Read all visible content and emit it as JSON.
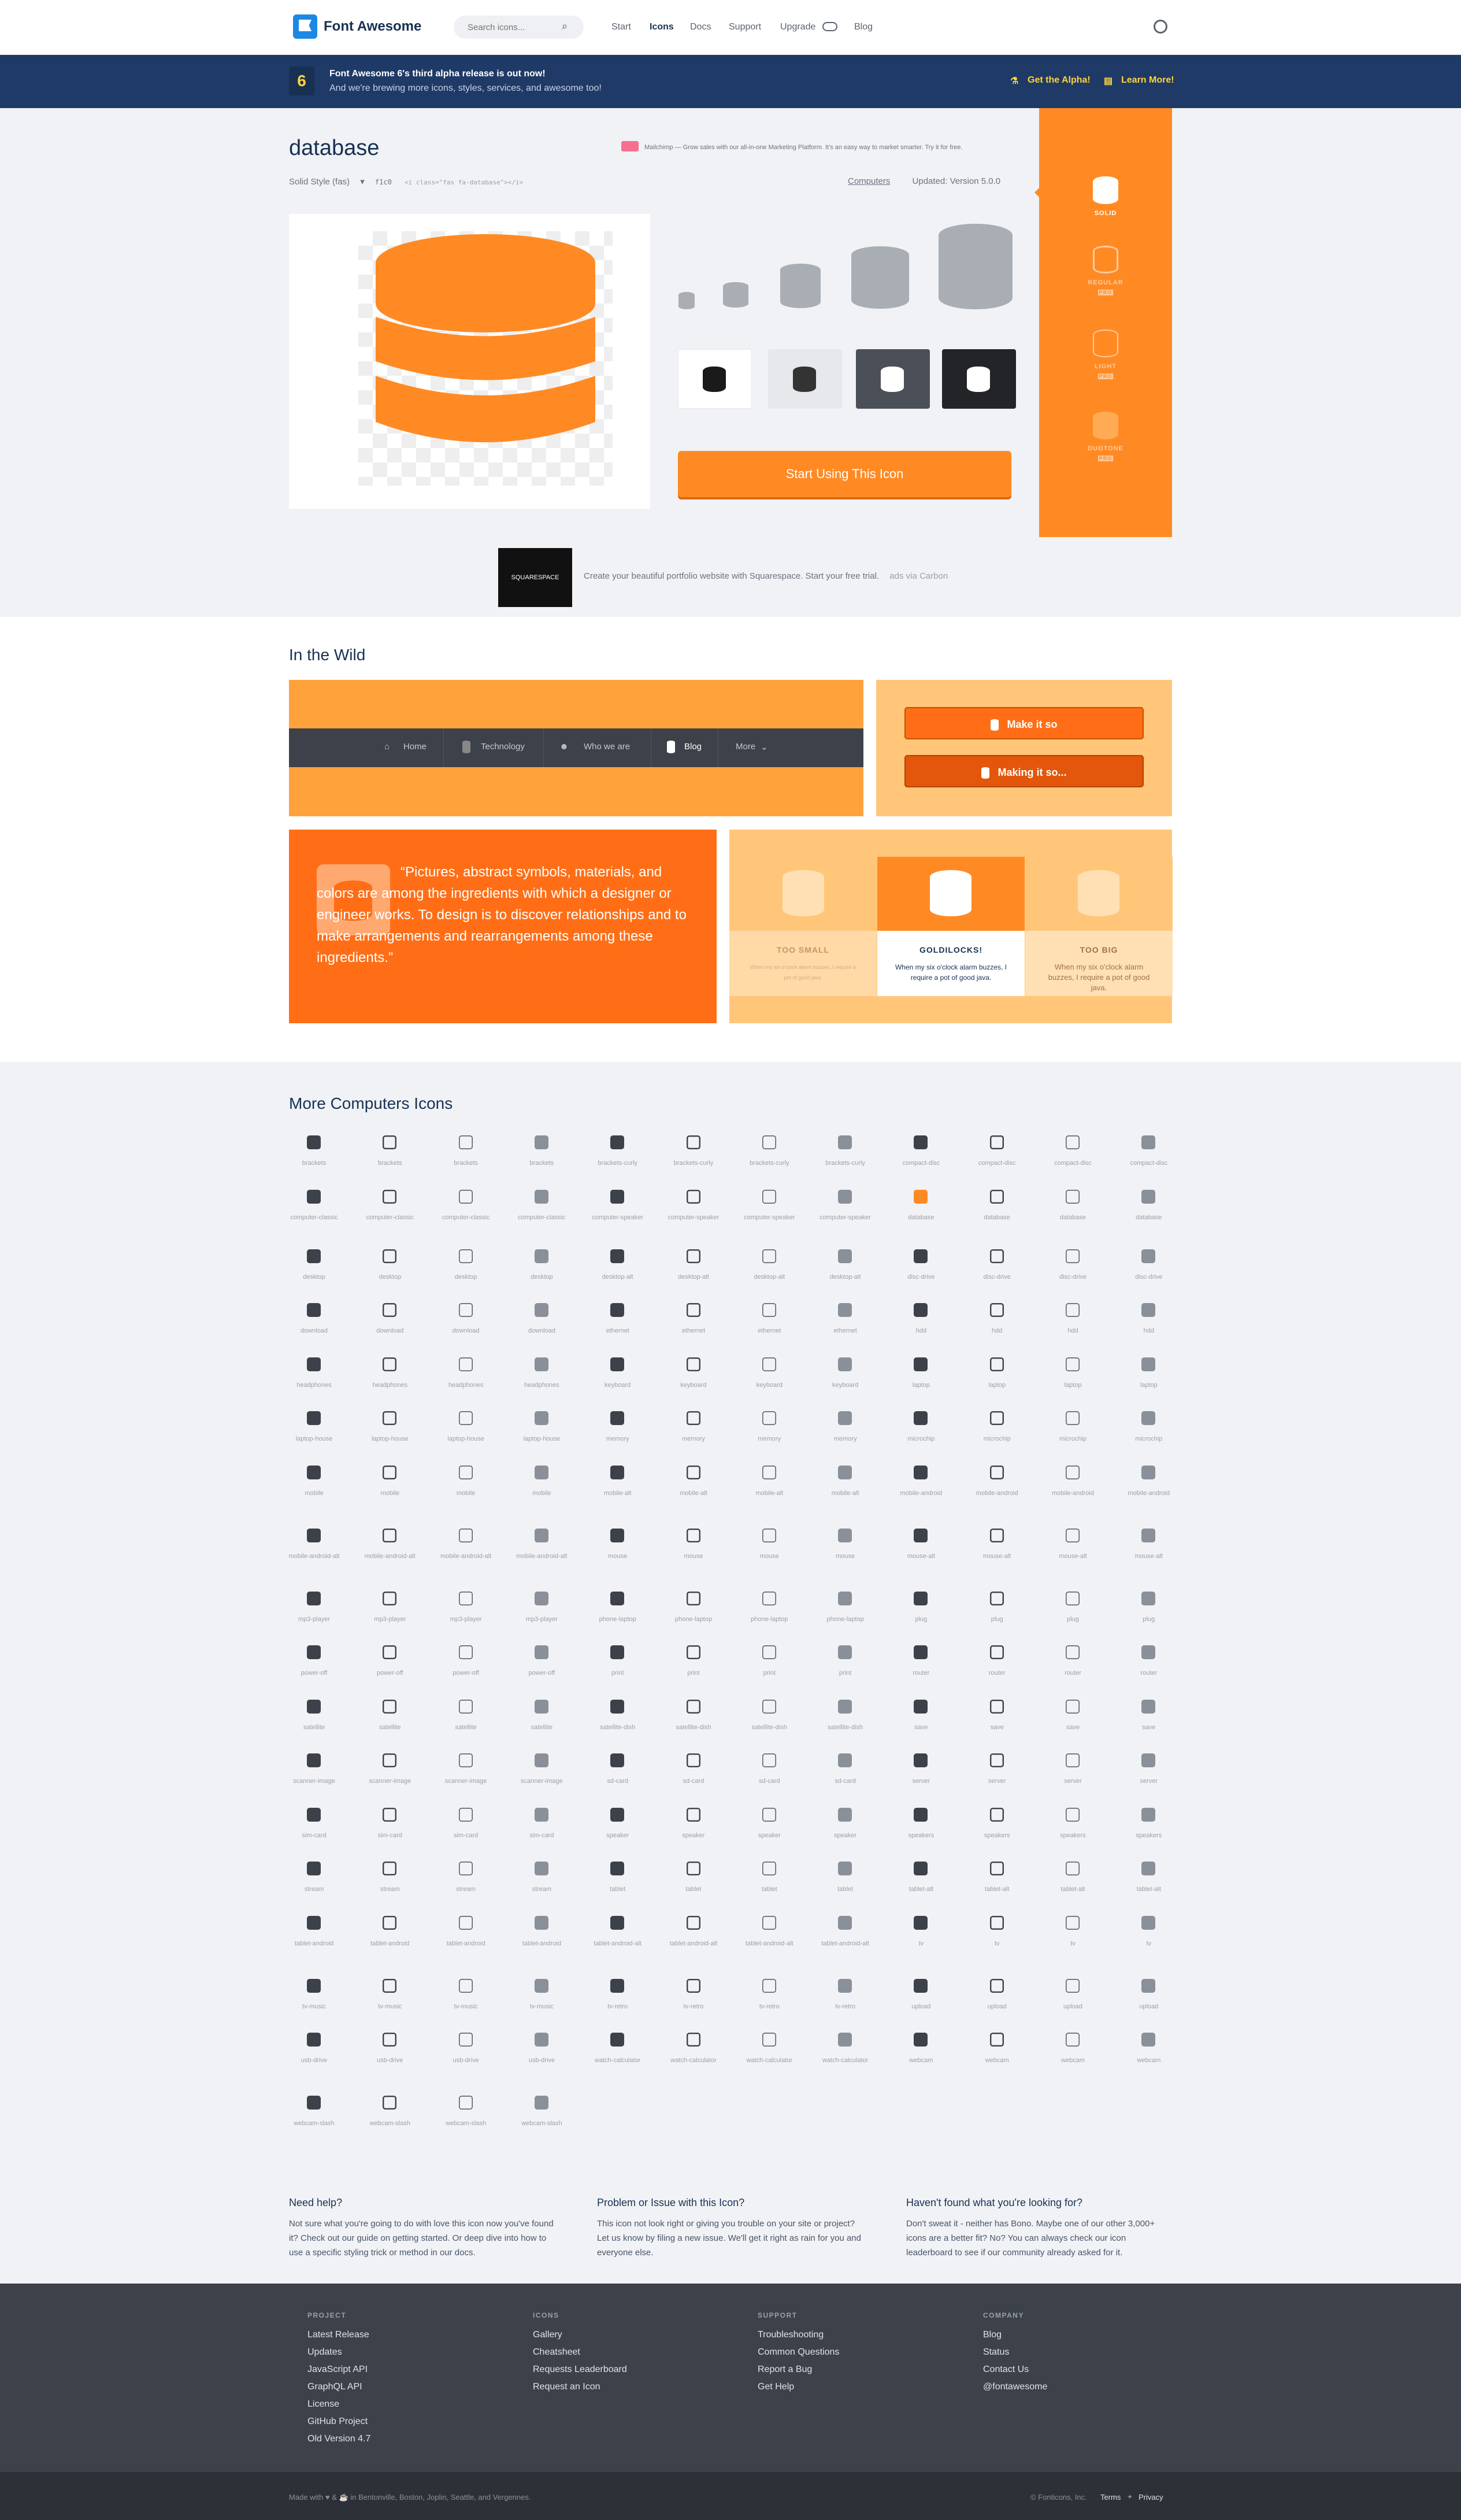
{
  "header": {
    "brand": "Font Awesome",
    "search_placeholder": "Search icons...",
    "nav": [
      "Start",
      "Icons",
      "Docs",
      "Support",
      "Upgrade",
      "Blog"
    ]
  },
  "banner": {
    "badge": "6",
    "headline": "Font Awesome 6's third alpha release is out now!",
    "subline": "And we're brewing more icons, styles, services, and awesome too!",
    "alpha_label": "Get the Alpha!",
    "learn_label": "Learn More!"
  },
  "icon": {
    "name": "database",
    "style_label": "Solid Style (fas)",
    "unicode": "f1c0",
    "snippet": "<i class=\"fas fa-database\"></i>",
    "category": "Computers",
    "updated": "Updated: Version 5.0.0",
    "ad": "Mailchimp — Grow sales with our all-in-one Marketing Platform. It's an easy way to market smarter. Try it for free.",
    "cta": "Start Using This Icon"
  },
  "styles": [
    "SOLID",
    "REGULAR",
    "LIGHT",
    "DUOTONE"
  ],
  "pro_badge": "PRO",
  "carbon": {
    "logo": "SQUARESPACE",
    "text": "Create your beautiful portfolio website with Squarespace. Start your free trial.",
    "via": "ads via Carbon"
  },
  "wild": {
    "title": "In the Wild",
    "nav_items": [
      "Home",
      "Technology",
      "Who we are",
      "Blog",
      "More"
    ],
    "button1": "Make it so",
    "button2": "Making it so...",
    "quote": "“Pictures, abstract symbols, materials, and colors are among the ingredients with which a designer or engineer works. To design is to discover relationships and to make arrangements and rearrangements among these ingredients.”",
    "sizes": [
      {
        "label": "TOO SMALL",
        "desc": "When my six o'clock alarm buzzes, I require a pot of good java."
      },
      {
        "label": "GOLDILOCKS!",
        "desc": "When my six o'clock alarm buzzes, I require a pot of good java."
      },
      {
        "label": "TOO BIG",
        "desc": "When my six o'clock alarm buzzes, I require a pot of good java."
      }
    ]
  },
  "more": {
    "title": "More Computers Icons",
    "labels": [
      "brackets",
      "brackets",
      "brackets",
      "brackets",
      "brackets-curly",
      "brackets-curly",
      "brackets-curly",
      "brackets-curly",
      "compact-disc",
      "compact-disc",
      "compact-disc",
      "compact-disc",
      "computer-classic",
      "computer-classic",
      "computer-classic",
      "computer-classic",
      "computer-speaker",
      "computer-speaker",
      "computer-speaker",
      "computer-speaker",
      "database",
      "database",
      "database",
      "database",
      "desktop",
      "desktop",
      "desktop",
      "desktop",
      "desktop-alt",
      "desktop-alt",
      "desktop-alt",
      "desktop-alt",
      "disc-drive",
      "disc-drive",
      "disc-drive",
      "disc-drive",
      "download",
      "download",
      "download",
      "download",
      "ethernet",
      "ethernet",
      "ethernet",
      "ethernet",
      "hdd",
      "hdd",
      "hdd",
      "hdd",
      "headphones",
      "headphones",
      "headphones",
      "headphones",
      "keyboard",
      "keyboard",
      "keyboard",
      "keyboard",
      "laptop",
      "laptop",
      "laptop",
      "laptop",
      "laptop-house",
      "laptop-house",
      "laptop-house",
      "laptop-house",
      "memory",
      "memory",
      "memory",
      "memory",
      "microchip",
      "microchip",
      "microchip",
      "microchip",
      "mobile",
      "mobile",
      "mobile",
      "mobile",
      "mobile-alt",
      "mobile-alt",
      "mobile-alt",
      "mobile-alt",
      "mobile-android",
      "mobile-android",
      "mobile-android",
      "mobile-android",
      "mobile-android-alt",
      "mobile-android-alt",
      "mobile-android-alt",
      "mobile-android-alt",
      "mouse",
      "mouse",
      "mouse",
      "mouse",
      "mouse-alt",
      "mouse-alt",
      "mouse-alt",
      "mouse-alt",
      "mp3-player",
      "mp3-player",
      "mp3-player",
      "mp3-player",
      "phone-laptop",
      "phone-laptop",
      "phone-laptop",
      "phone-laptop",
      "plug",
      "plug",
      "plug",
      "plug",
      "power-off",
      "power-off",
      "power-off",
      "power-off",
      "print",
      "print",
      "print",
      "print",
      "router",
      "router",
      "router",
      "router",
      "satellite",
      "satellite",
      "satellite",
      "satellite",
      "satellite-dish",
      "satellite-dish",
      "satellite-dish",
      "satellite-dish",
      "save",
      "save",
      "save",
      "save",
      "scanner-image",
      "scanner-image",
      "scanner-image",
      "scanner-image",
      "sd-card",
      "sd-card",
      "sd-card",
      "sd-card",
      "server",
      "server",
      "server",
      "server",
      "sim-card",
      "sim-card",
      "sim-card",
      "sim-card",
      "speaker",
      "speaker",
      "speaker",
      "speaker",
      "speakers",
      "speakers",
      "speakers",
      "speakers",
      "stream",
      "stream",
      "stream",
      "stream",
      "tablet",
      "tablet",
      "tablet",
      "tablet",
      "tablet-alt",
      "tablet-alt",
      "tablet-alt",
      "tablet-alt",
      "tablet-android",
      "tablet-android",
      "tablet-android",
      "tablet-android",
      "tablet-android-alt",
      "tablet-android-alt",
      "tablet-android-alt",
      "tablet-android-alt",
      "tv",
      "tv",
      "tv",
      "tv",
      "tv-music",
      "tv-music",
      "tv-music",
      "tv-music",
      "tv-retro",
      "tv-retro",
      "tv-retro",
      "tv-retro",
      "upload",
      "upload",
      "upload",
      "upload",
      "usb-drive",
      "usb-drive",
      "usb-drive",
      "usb-drive",
      "watch-calculator",
      "watch-calculator",
      "watch-calculator",
      "watch-calculator",
      "webcam",
      "webcam",
      "webcam",
      "webcam",
      "webcam-slash",
      "webcam-slash",
      "webcam-slash",
      "webcam-slash"
    ]
  },
  "help": {
    "need_title": "Need help?",
    "need_text": "Not sure what you're going to do with love this icon now you've found it? Check out our guide on getting started. Or deep dive into how to use a specific styling trick or method in our docs.",
    "problem_title": "Problem or Issue with this Icon?",
    "problem_text": "This icon not look right or giving you trouble on your site or project? Let us know by filing a new issue. We'll get it right as rain for you and everyone else.",
    "found_title": "Haven't found what you're looking for?",
    "found_text": "Don't sweat it - neither has Bono. Maybe one of our other 3,000+ icons are a better fit? No? You can always check our icon leaderboard to see if our community already asked for it."
  },
  "footer": {
    "columns": [
      {
        "title": "PROJECT",
        "links": [
          "Latest Release",
          "Updates",
          "JavaScript API",
          "GraphQL API",
          "License",
          "GitHub Project",
          "Old Version 4.7"
        ]
      },
      {
        "title": "ICONS",
        "links": [
          "Gallery",
          "Cheatsheet",
          "Requests Leaderboard",
          "Request an Icon"
        ]
      },
      {
        "title": "SUPPORT",
        "links": [
          "Troubleshooting",
          "Common Questions",
          "Report a Bug",
          "Get Help"
        ]
      },
      {
        "title": "COMPANY",
        "links": [
          "Blog",
          "Status",
          "Contact Us",
          "@fontawesome"
        ]
      }
    ],
    "made": "Made with ♥ & ☕ in Bentonville, Boston, Joplin, Seattle, and Vergennes.",
    "copyright": "© Fonticons, Inc.",
    "terms": "Terms",
    "privacy": "Privacy"
  },
  "colors": {
    "accent": "#ff8a24",
    "navy": "#183153",
    "banner": "#1f3a66",
    "blue": "#1c88e5"
  }
}
